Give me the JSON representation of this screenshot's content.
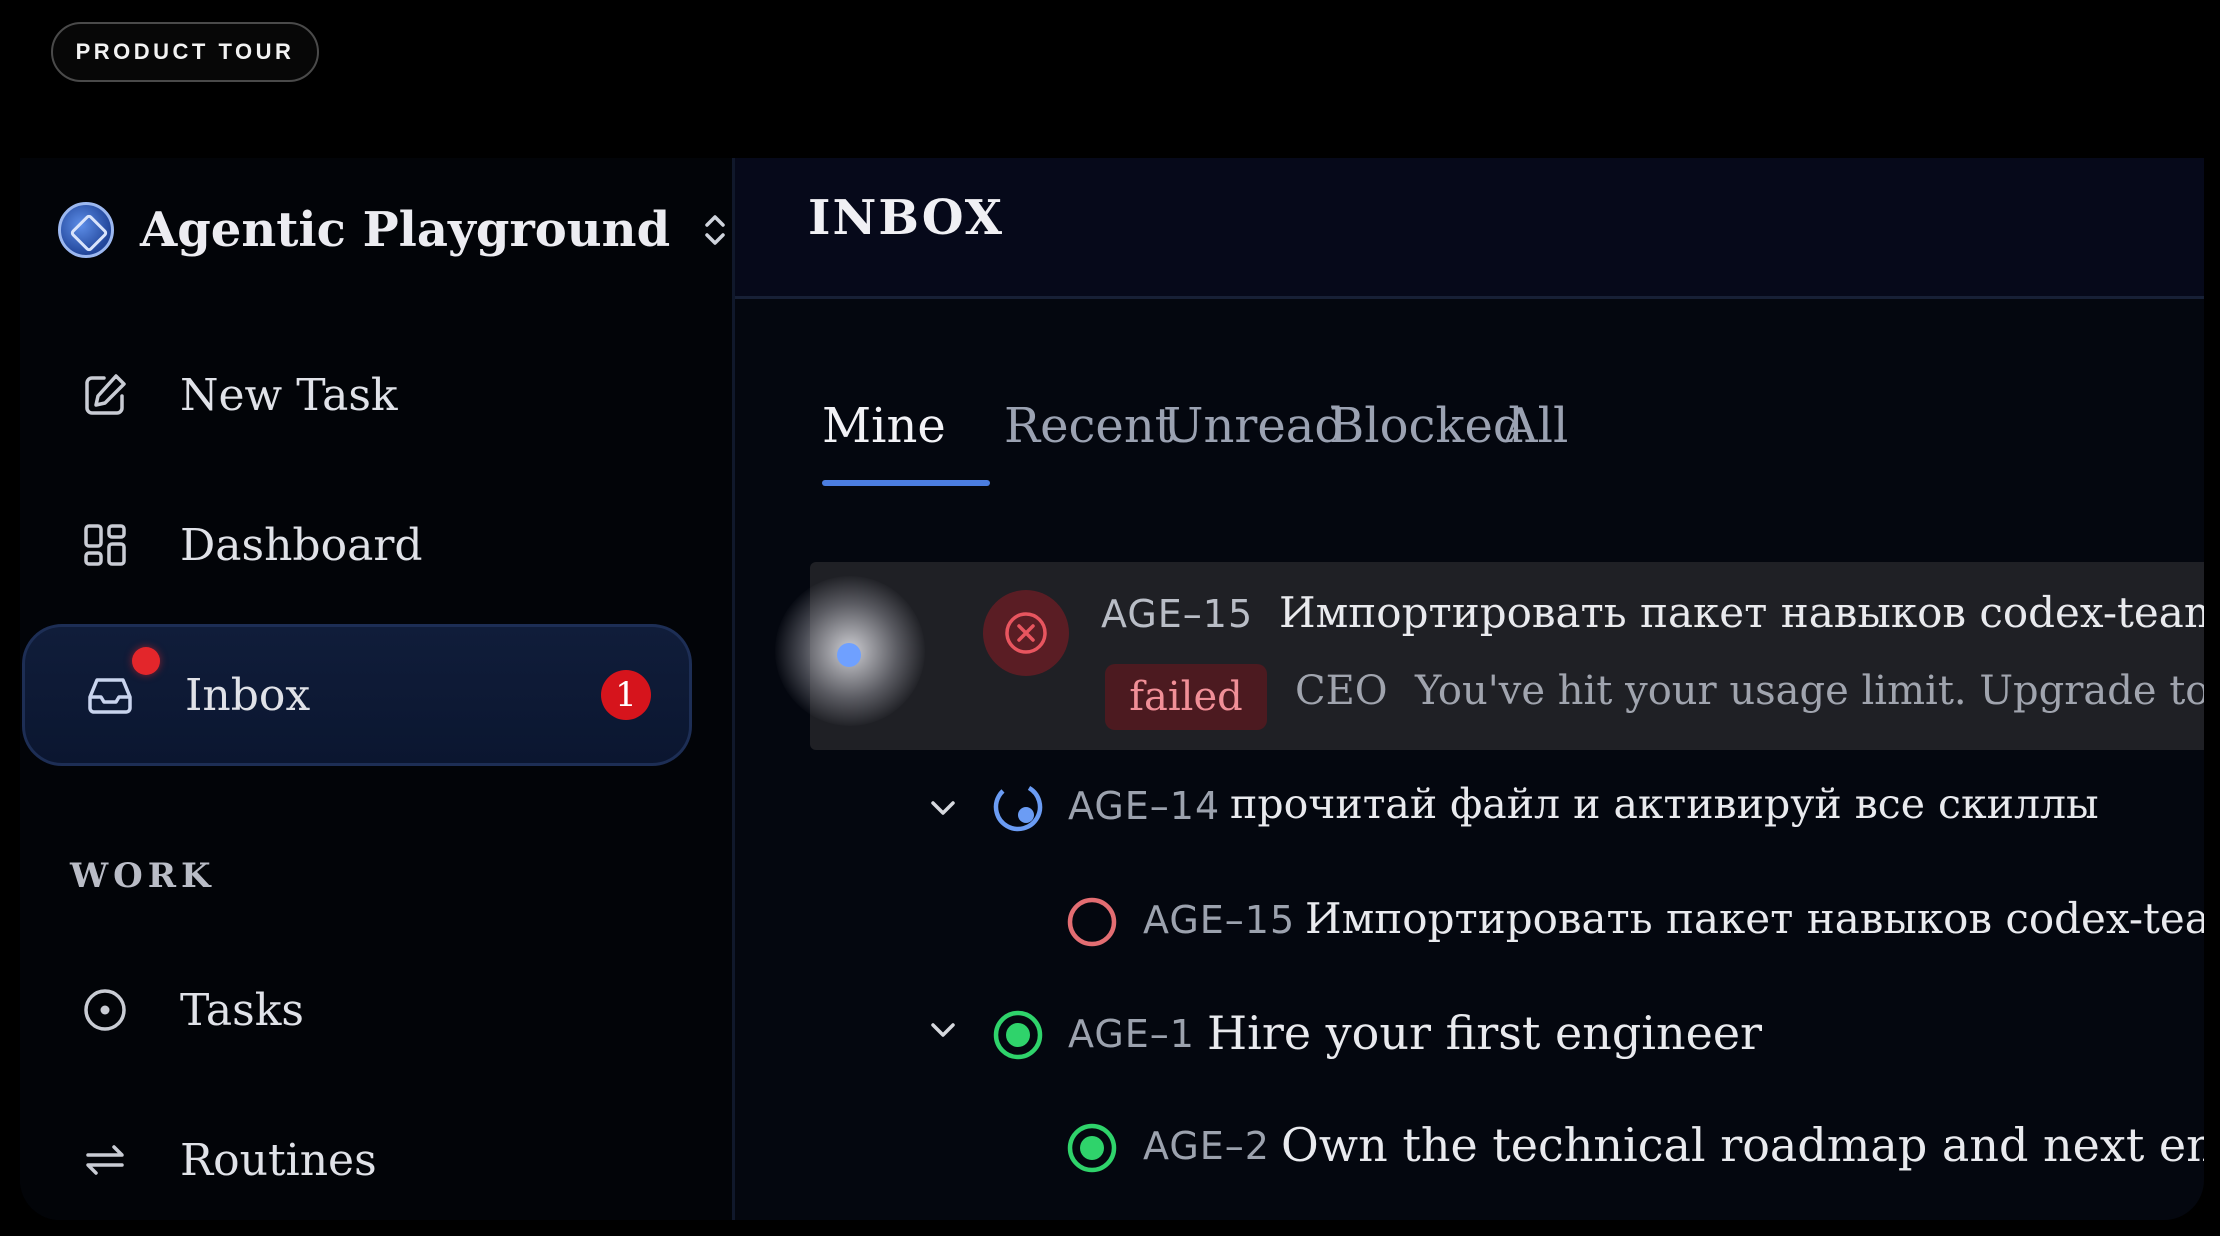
{
  "overlay": {
    "tour_label": "PRODUCT TOUR"
  },
  "sidebar": {
    "workspace_name": "Agentic Playground",
    "nav": [
      {
        "label": "New Task",
        "icon": "edit-icon"
      },
      {
        "label": "Dashboard",
        "icon": "dashboard-icon"
      },
      {
        "label": "Inbox",
        "icon": "inbox-icon",
        "badge": "1"
      }
    ],
    "section_work": "WORK",
    "work_items": [
      {
        "label": "Tasks",
        "icon": "tasks-icon"
      },
      {
        "label": "Routines",
        "icon": "routines-icon"
      }
    ]
  },
  "main": {
    "title": "INBOX",
    "tabs": [
      "Mine",
      "Recent",
      "Unread",
      "Blocked",
      "All"
    ],
    "active_tab": "Mine",
    "items": [
      {
        "id": "AGE–15",
        "title": "Импортировать пакет навыков codex-team-",
        "status": "failed",
        "actor": "CEO",
        "snippet": "You've hit your usage limit. Upgrade to Plu"
      },
      {
        "id": "AGE–14",
        "title": "прочитай файл и активируй все скиллы",
        "status": "in-progress"
      },
      {
        "id": "AGE–15",
        "title": "Импортировать пакет навыков codex-team",
        "status": "todo"
      },
      {
        "id": "AGE–1",
        "title": "Hire your first engineer",
        "status": "done"
      },
      {
        "id": "AGE–2",
        "title": "Own the technical roadmap and next engi",
        "status": "done"
      }
    ]
  },
  "colors": {
    "accent": "#4b7de0",
    "danger": "#d6141c",
    "success": "#22c55e",
    "todo": "#e06a6a"
  }
}
